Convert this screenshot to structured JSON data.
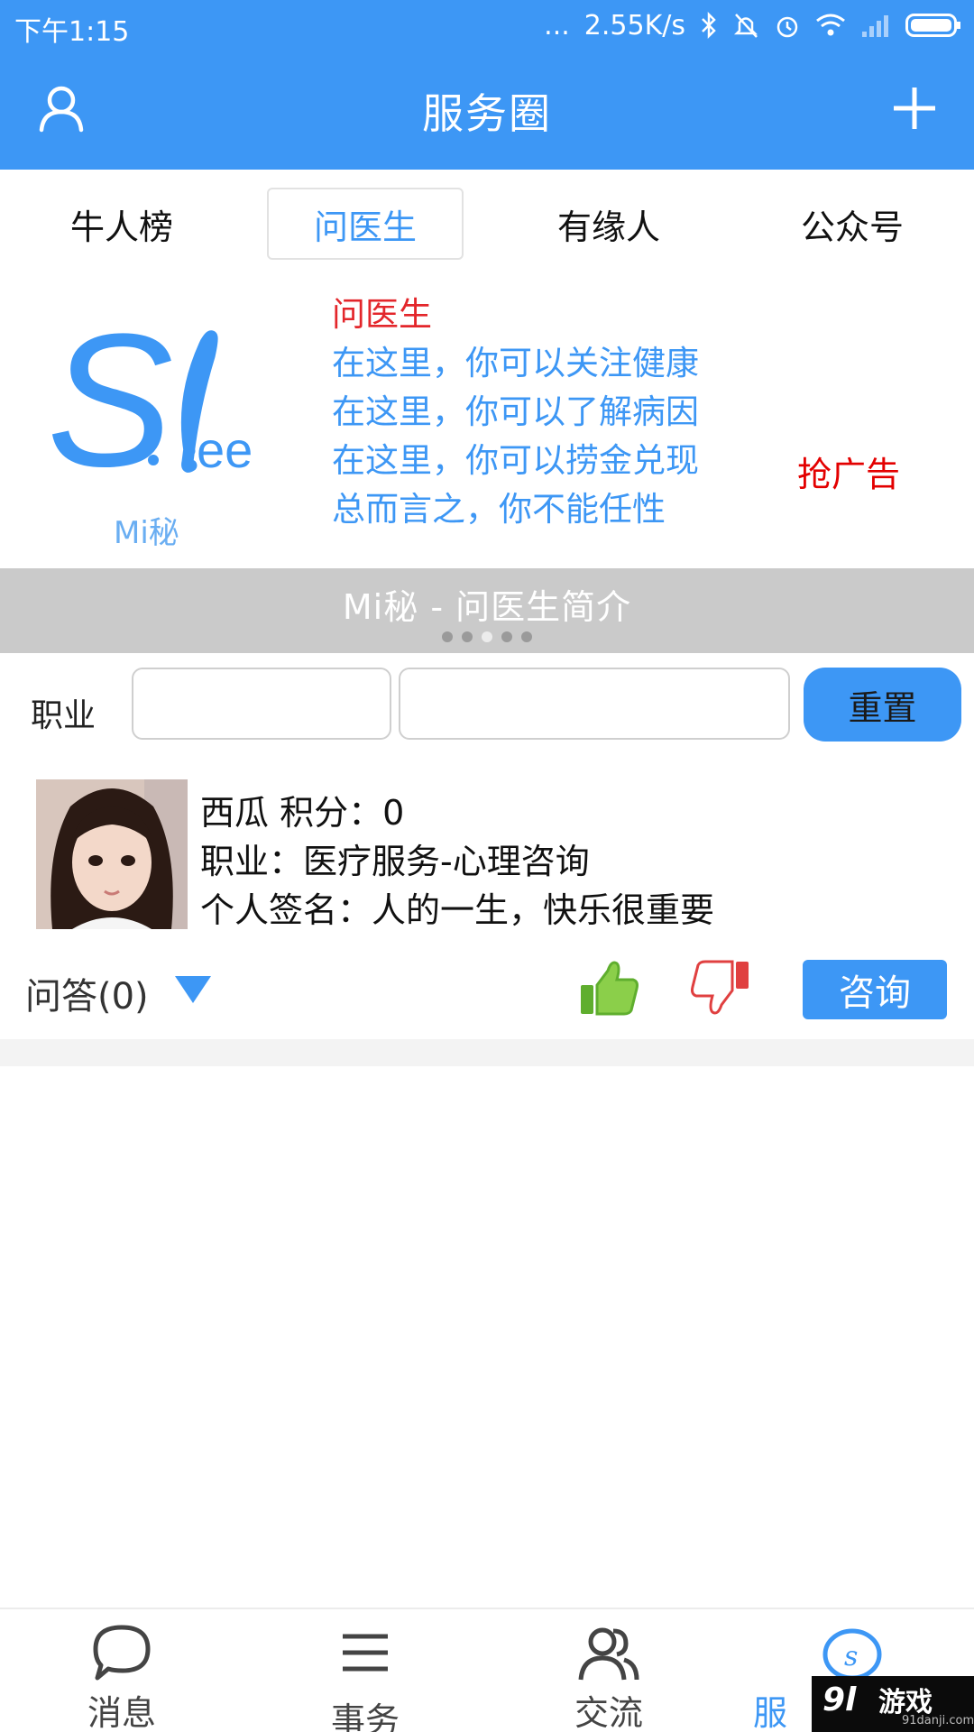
{
  "status_bar": {
    "time": "下午1:15",
    "speed": "2.55K/s",
    "dots": "...",
    "icons": [
      "bluetooth-icon",
      "mute-icon",
      "alarm-icon",
      "wifi-icon",
      "signal-icon",
      "battery-icon"
    ]
  },
  "header": {
    "title": "服务圈",
    "left_icon": "user-icon",
    "right_icon": "plus-icon"
  },
  "tabs": [
    {
      "label": "牛人榜",
      "active": false
    },
    {
      "label": "问医生",
      "active": true
    },
    {
      "label": "有缘人",
      "active": false
    },
    {
      "label": "公众号",
      "active": false
    }
  ],
  "banner": {
    "logo_text": "S.lee",
    "logo_sub": "Mi秘",
    "lines": [
      "问医生",
      "在这里，你可以关注健康",
      "在这里，你可以了解病因",
      "在这里，你可以捞金兑现",
      "总而言之，你不能任性"
    ],
    "ad_text": "抢广告",
    "caption": "Mi秘 - 问医生简介",
    "page_count": 5,
    "active_page": 3
  },
  "filter": {
    "label": "职业",
    "input1_value": "",
    "input2_value": "",
    "reset_label": "重置"
  },
  "user_card": {
    "name_line": "西瓜   积分：0",
    "job_line": "职业：医疗服务-心理咨询",
    "signature_line": "个人签名：人的一生，快乐很重要",
    "qa_label": "问答(0)",
    "consult_label": "咨询"
  },
  "bottom_nav": [
    {
      "label": "消息",
      "icon": "chat-bubble-icon",
      "active": false
    },
    {
      "label": "事务",
      "icon": "menu-lines-icon",
      "active": false
    },
    {
      "label": "交流",
      "icon": "people-icon",
      "active": false
    },
    {
      "label": "服",
      "icon": "service-circle-icon",
      "active": true
    }
  ],
  "watermark": {
    "main": "游戏",
    "logo": "9l",
    "sub": "91danji.com"
  },
  "colors": {
    "accent": "#3d97f5",
    "ad_red": "#e30000",
    "caption_gray": "#cacaca"
  }
}
